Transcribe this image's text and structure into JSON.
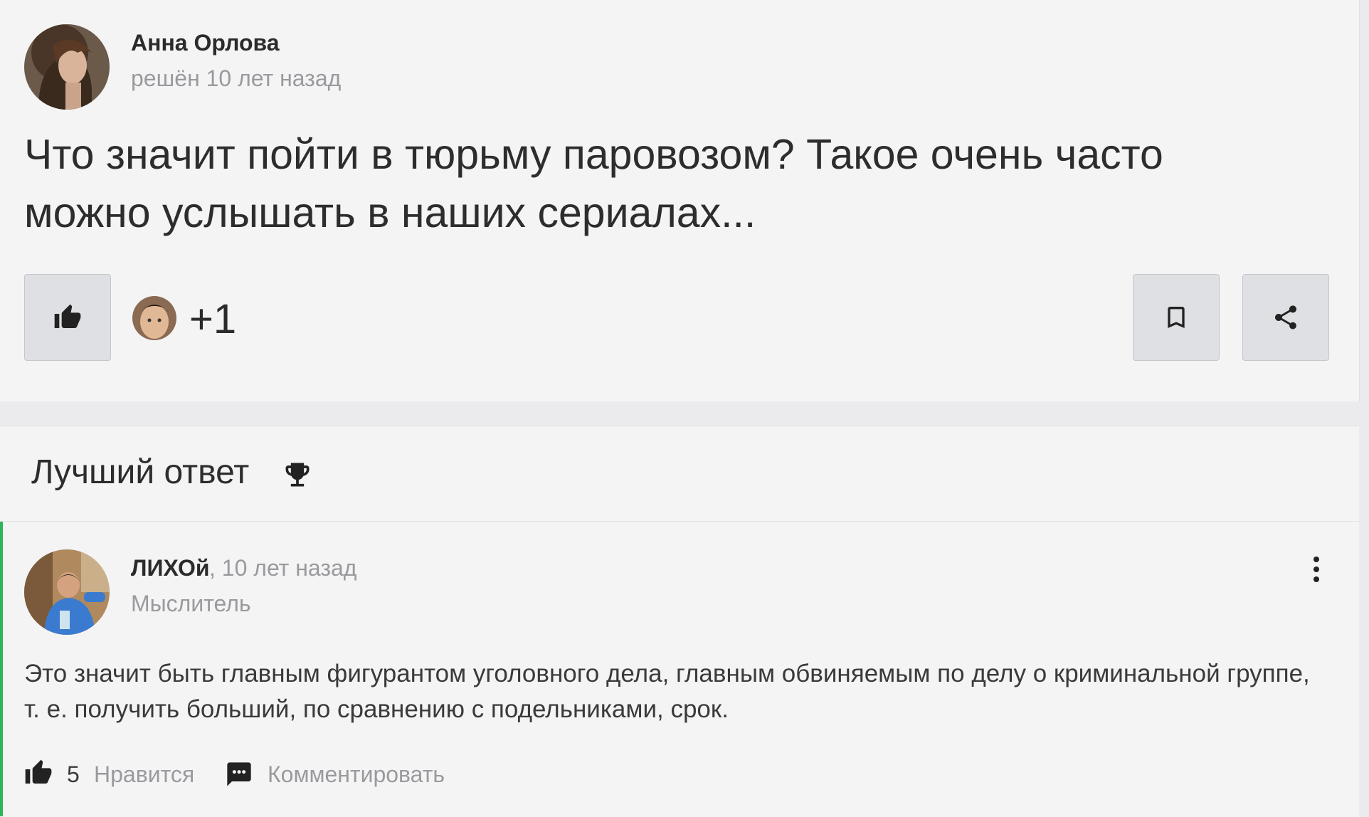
{
  "question": {
    "author": "Анна Орлова",
    "status": "решён 10 лет назад",
    "text": "Что значит пойти в тюрьму паровозом? Такое очень часто можно услышать в наших сериалах...",
    "like_count": "+1"
  },
  "best_answer": {
    "title": "Лучший ответ",
    "author": "ЛИХОй",
    "time": ", 10 лет назад",
    "rank": "Мыслитель",
    "text": "Это значит быть главным фигурантом уголовного дела, главным обвиняемым по делу о криминальной группе, т. е. получить больший, по сравнению с подельниками, срок.",
    "likes": "5",
    "like_label": "Нравится",
    "comment_label": "Комментировать"
  },
  "colors": {
    "accent_green": "#2fb45a",
    "button_bg": "#dfe0e4",
    "card_bg": "#f4f4f5"
  },
  "icons": [
    "thumbs-up-icon",
    "bookmark-icon",
    "share-icon",
    "trophy-icon",
    "more-vertical-icon",
    "comment-icon"
  ]
}
